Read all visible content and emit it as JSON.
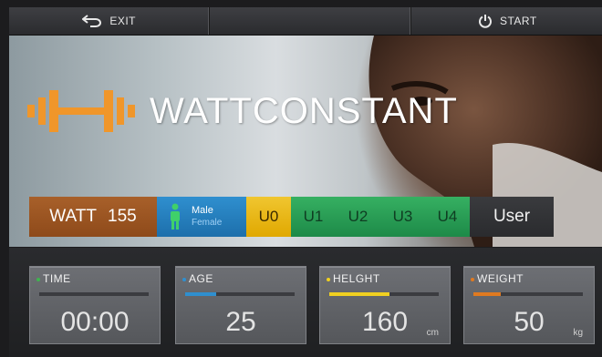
{
  "topbar": {
    "exit_label": "EXIT",
    "start_label": "START"
  },
  "hero": {
    "title": "WATTCONSTANT"
  },
  "profile": {
    "watt_label": "WATT",
    "watt_value": "155",
    "gender_male": "Male",
    "gender_female": "Female",
    "users": [
      "U0",
      "U1",
      "U2",
      "U3",
      "U4"
    ],
    "user_label": "User"
  },
  "metrics": {
    "time": {
      "label": "TIME",
      "value": "00:00",
      "color": "#3fb34f"
    },
    "age": {
      "label": "AGE",
      "value": "25",
      "color": "#2f8fcf",
      "level": 0.28
    },
    "height": {
      "label": "HELGHT",
      "value": "160",
      "unit": "cm",
      "color": "#f0d020",
      "level": 0.55
    },
    "weight": {
      "label": "WEIGHT",
      "value": "50",
      "unit": "kg",
      "color": "#e07a20",
      "level": 0.25
    }
  },
  "colors": {
    "accent_orange": "#f0962a",
    "gender_blue": "#2f8fcf",
    "user_green": "#1d8a48",
    "user_yellow": "#e0a800"
  },
  "icons": {
    "exit": "return-arrow-icon",
    "start": "power-icon",
    "logo": "dumbbell-icon",
    "gender": "person-icon"
  }
}
